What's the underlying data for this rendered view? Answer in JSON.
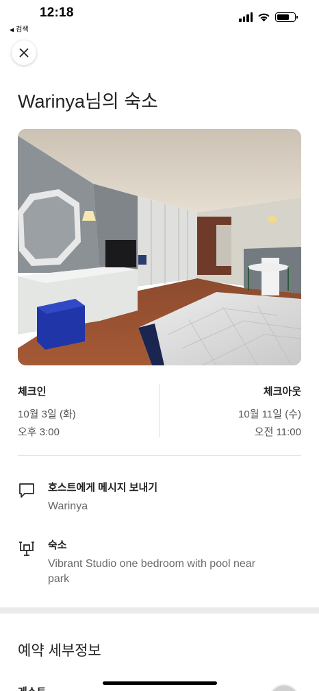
{
  "status_bar": {
    "time": "12:18",
    "back_label": "검색",
    "back_arrow": "◀"
  },
  "header": {
    "title": "Warinya님의 숙소"
  },
  "check_in": {
    "label": "체크인",
    "date": "10월 3일 (화)",
    "time": "오후 3:00"
  },
  "check_out": {
    "label": "체크아웃",
    "date": "10월 11일 (수)",
    "time": "오전 11:00"
  },
  "host_message": {
    "icon": "chat-bubble-icon",
    "title": "호스트에게 메시지 보내기",
    "host_name": "Warinya"
  },
  "listing": {
    "icon": "listing-board-icon",
    "title": "숙소",
    "name": "Vibrant Studio one bedroom with pool near park"
  },
  "reservation": {
    "section_title": "예약 세부정보",
    "guest_label": "게스트"
  }
}
